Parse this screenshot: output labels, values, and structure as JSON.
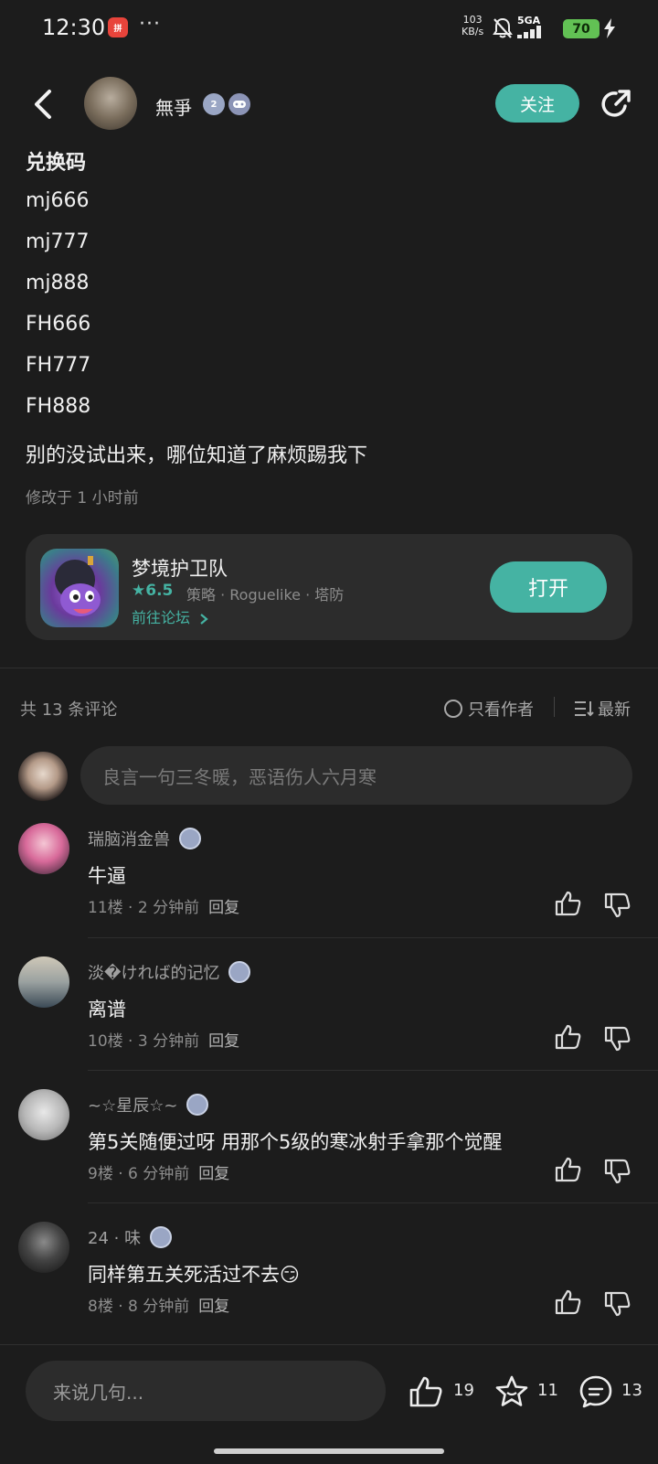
{
  "status_bar": {
    "time": "12:30",
    "app_badge": "拼",
    "more": "···",
    "net_speed_value": "103",
    "net_speed_unit": "KB/s",
    "signal_label": "5GA",
    "battery": "70"
  },
  "header": {
    "author_name": "無爭",
    "level_badge": "2",
    "follow_label": "关注"
  },
  "post": {
    "lines": [
      "兑换码",
      "mj666",
      "mj777",
      "mj888",
      "FH666",
      "FH777",
      "FH888",
      "别的没试出来，哪位知道了麻烦踢我下"
    ],
    "edited": "修改于 1 小时前"
  },
  "game_card": {
    "name": "梦境护卫队",
    "rating": "★6.5",
    "tags": "策略 · Roguelike · 塔防",
    "forum_link": "前往论坛",
    "open_label": "打开"
  },
  "comments_header": {
    "count": "共 13 条评论",
    "author_only": "只看作者",
    "sort": "最新"
  },
  "comment_input_placeholder": "良言一句三冬暖，恶语伤人六月寒",
  "comments": [
    {
      "user": "瑞脑消金兽",
      "text": "牛逼",
      "floor": "11楼",
      "time": "2 分钟前",
      "reply": "回复"
    },
    {
      "user": "淡�ければ的记忆",
      "text": "离谱",
      "floor": "10楼",
      "time": "3 分钟前",
      "reply": "回复"
    },
    {
      "user": "~☆星辰☆~",
      "text": "第5关随便过呀 用那个5级的寒冰射手拿那个觉醒",
      "floor": "9楼",
      "time": "6 分钟前",
      "reply": "回复"
    },
    {
      "user": "24 · 味",
      "text": "同样第五关死活过不去😏",
      "floor": "8楼",
      "time": "8 分钟前",
      "reply": "回复"
    }
  ],
  "bottom_bar": {
    "placeholder": "来说几句...",
    "likes": "19",
    "stars": "11",
    "comments": "13"
  }
}
